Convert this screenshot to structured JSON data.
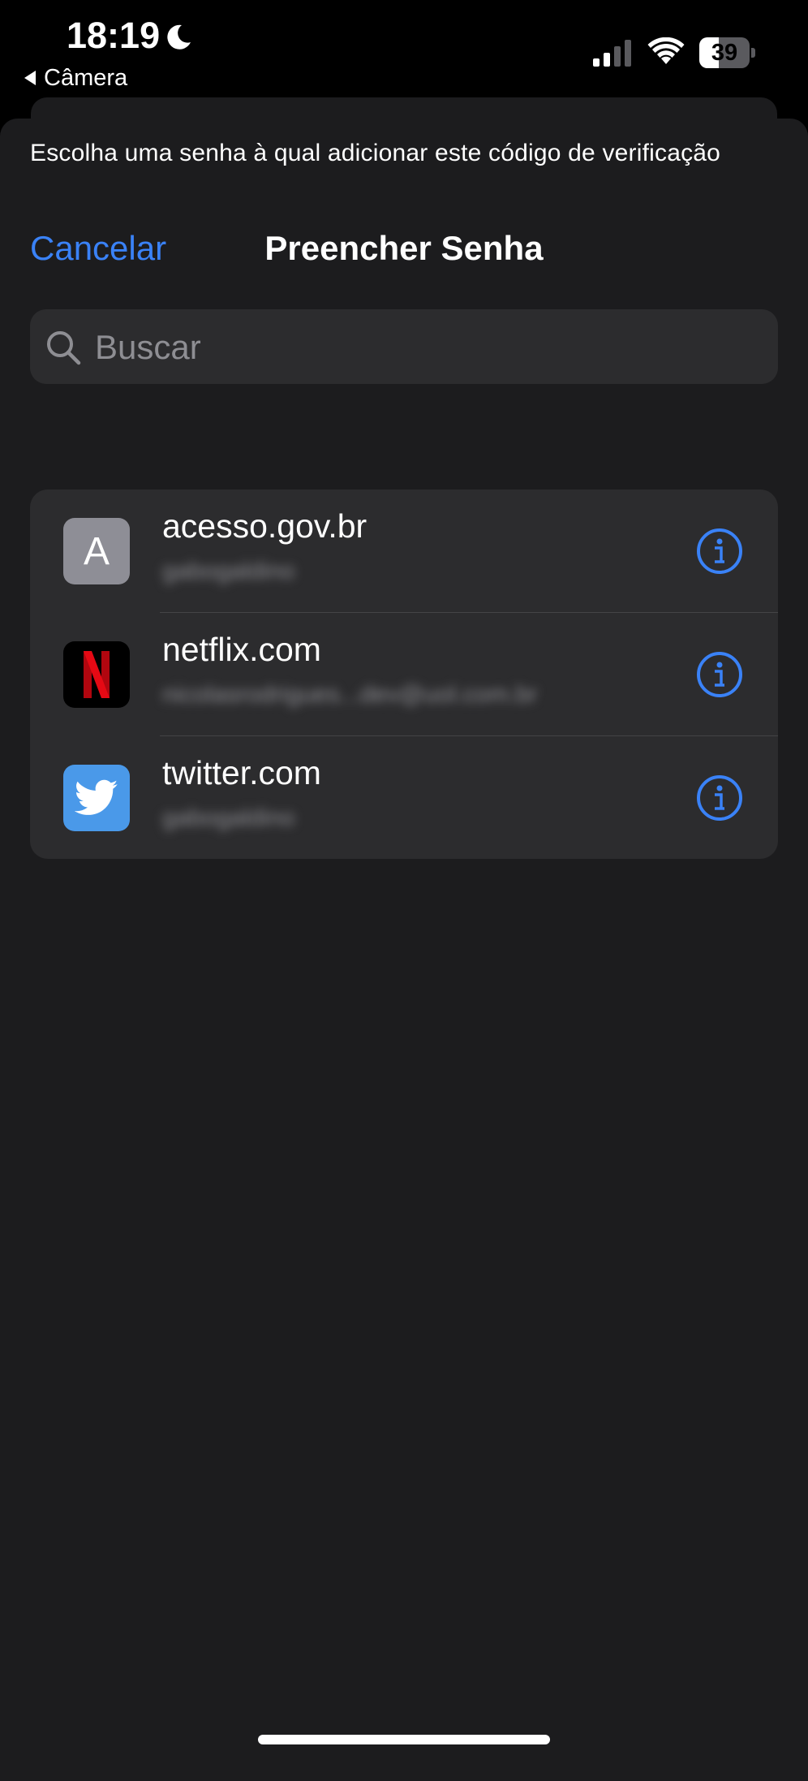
{
  "status_bar": {
    "time": "18:19",
    "back_label": "Câmera",
    "battery_level": "39",
    "battery_fraction": 0.39
  },
  "sheet": {
    "prompt": "Escolha uma senha à qual adicionar este código de verificação",
    "cancel_label": "Cancelar",
    "title": "Preencher Senha"
  },
  "search": {
    "placeholder": "Buscar",
    "value": ""
  },
  "accounts": [
    {
      "domain": "acesso.gov.br",
      "user": "gabogaldino",
      "icon": "letter-a-icon",
      "icon_letter": "A"
    },
    {
      "domain": "netflix.com",
      "user": "nicolasrodrigues...dev@uol.com.br",
      "icon": "netflix-icon",
      "icon_letter": "N"
    },
    {
      "domain": "twitter.com",
      "user": "gabogaldino",
      "icon": "twitter-bird-icon"
    }
  ],
  "colors": {
    "accent": "#3a82f7",
    "sheet_bg": "#1c1c1e",
    "cell_bg": "#2c2c2e",
    "netflix_red": "#e50914",
    "twitter_blue": "#4a99e9"
  }
}
